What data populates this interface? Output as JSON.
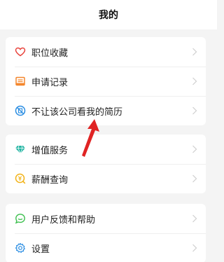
{
  "header": {
    "title": "我的"
  },
  "groups": [
    {
      "items": [
        {
          "icon": "heart-icon",
          "label": "职位收藏",
          "color": "#e8413a"
        },
        {
          "icon": "file-icon",
          "label": "申请记录",
          "color": "#f4872e"
        },
        {
          "icon": "block-company-icon",
          "label": "不让该公司看我的简历",
          "color": "#2a8de2"
        }
      ]
    },
    {
      "items": [
        {
          "icon": "diamond-icon",
          "label": "增值服务",
          "color": "#26b6a4"
        },
        {
          "icon": "salary-icon",
          "label": "薪酬查询",
          "color": "#f2b319"
        }
      ]
    },
    {
      "items": [
        {
          "icon": "feedback-icon",
          "label": "用户反馈和帮助",
          "color": "#3bbf4d"
        },
        {
          "icon": "gear-icon",
          "label": "设置",
          "color": "#2a8de2"
        }
      ]
    }
  ],
  "annotation": {
    "color": "#e02424"
  }
}
